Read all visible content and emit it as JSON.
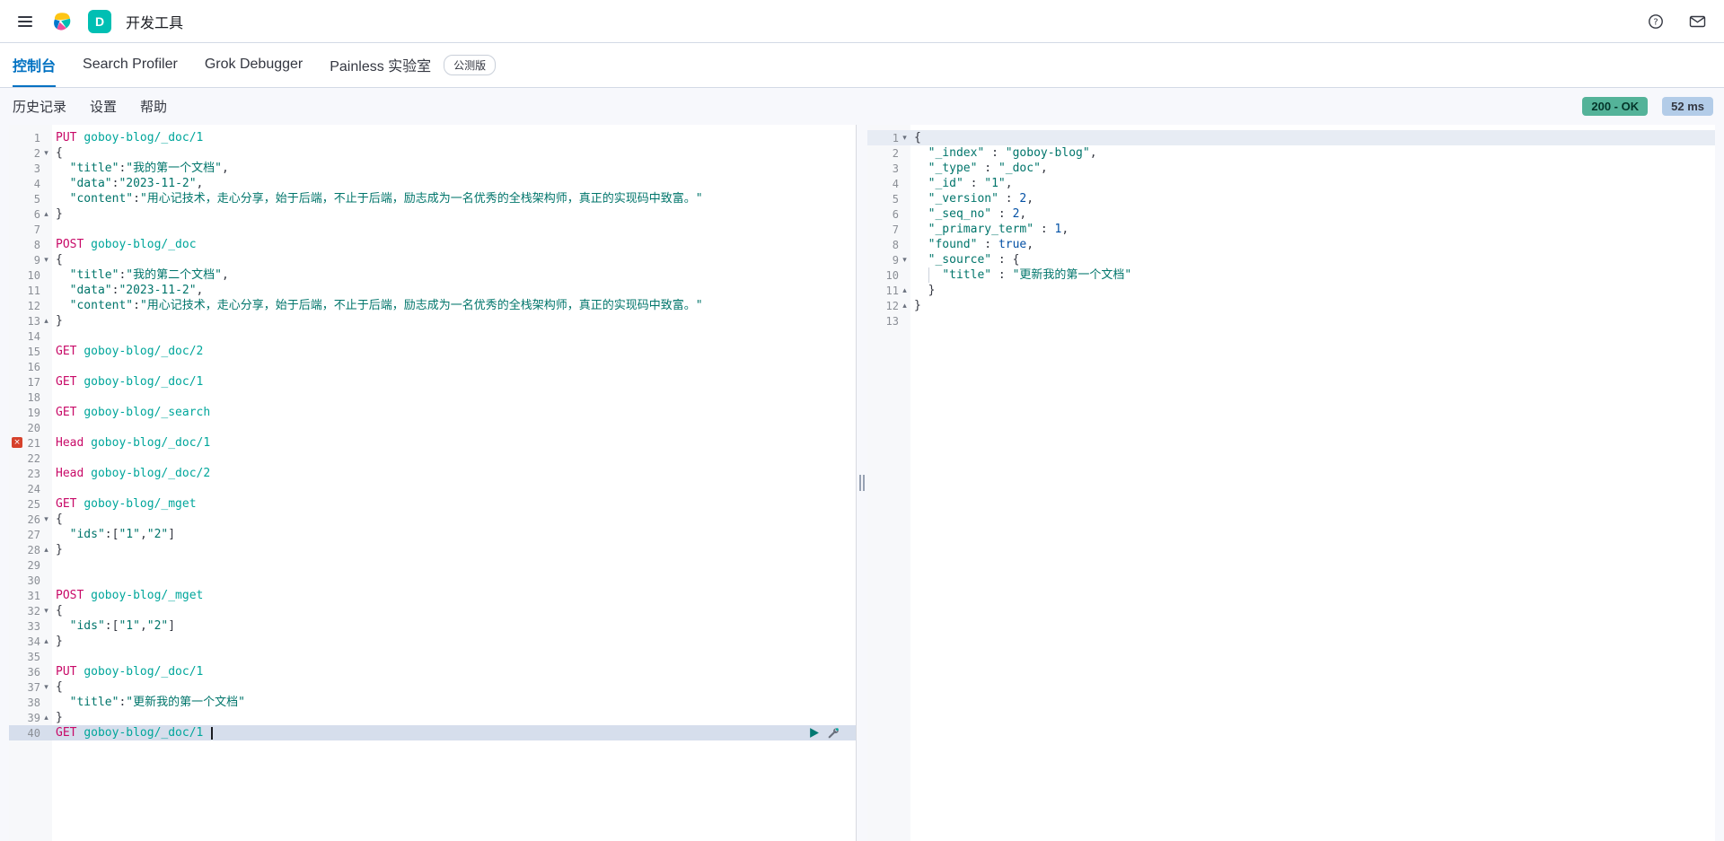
{
  "header": {
    "app_title": "开发工具",
    "space_badge": "D"
  },
  "tabs": [
    {
      "label": "控制台",
      "active": true
    },
    {
      "label": "Search Profiler",
      "active": false
    },
    {
      "label": "Grok Debugger",
      "active": false
    },
    {
      "label": "Painless 实验室",
      "active": false
    }
  ],
  "beta_badge": "公测版",
  "toolbar": {
    "items": [
      "历史记录",
      "设置",
      "帮助"
    ],
    "status_badge": "200 - OK",
    "time_badge": "52 ms"
  },
  "colors": {
    "accent": "#0071c2",
    "status_ok_badge": "#54b399",
    "time_badge": "#b3cce8",
    "method": "#c80a68",
    "url": "#00a69b",
    "string": "#00756b",
    "number": "#0451a5",
    "error_marker": "#d6412b",
    "space_badge": "#00bfb3"
  },
  "icons": {
    "menu": "hamburger-icon",
    "logo": "elastic-logo",
    "help": "help-icon",
    "newsfeed": "newsfeed-icon",
    "send_request": "play-icon",
    "request_options": "wrench-icon",
    "fold_open": "▾",
    "fold_close": "▴",
    "error": "×"
  },
  "editor_left": {
    "lines": [
      {
        "n": 1,
        "tokens": [
          [
            "m",
            "PUT"
          ],
          [
            "t",
            " "
          ],
          [
            "u",
            "goboy-blog/_doc/1"
          ]
        ]
      },
      {
        "n": 2,
        "fold": "open",
        "tokens": [
          [
            "t",
            "{"
          ]
        ]
      },
      {
        "n": 3,
        "tokens": [
          [
            "t",
            "  "
          ],
          [
            "k",
            "\"title\""
          ],
          [
            "t",
            ":"
          ],
          [
            "s",
            "\"我的第一个文档\""
          ],
          [
            "t",
            ","
          ]
        ]
      },
      {
        "n": 4,
        "tokens": [
          [
            "t",
            "  "
          ],
          [
            "k",
            "\"data\""
          ],
          [
            "t",
            ":"
          ],
          [
            "s",
            "\"2023-11-2\""
          ],
          [
            "t",
            ","
          ]
        ]
      },
      {
        "n": 5,
        "tokens": [
          [
            "t",
            "  "
          ],
          [
            "k",
            "\"content\""
          ],
          [
            "t",
            ":"
          ],
          [
            "s",
            "\"用心记技术，走心分享，始于后端，不止于后端，励志成为一名优秀的全栈架构师，真正的实现码中致富。\""
          ]
        ]
      },
      {
        "n": 6,
        "fold": "close",
        "tokens": [
          [
            "t",
            "}"
          ]
        ]
      },
      {
        "n": 7,
        "tokens": []
      },
      {
        "n": 8,
        "tokens": [
          [
            "m",
            "POST"
          ],
          [
            "t",
            " "
          ],
          [
            "u",
            "goboy-blog/_doc"
          ]
        ]
      },
      {
        "n": 9,
        "fold": "open",
        "tokens": [
          [
            "t",
            "{"
          ]
        ]
      },
      {
        "n": 10,
        "tokens": [
          [
            "t",
            "  "
          ],
          [
            "k",
            "\"title\""
          ],
          [
            "t",
            ":"
          ],
          [
            "s",
            "\"我的第二个文档\""
          ],
          [
            "t",
            ","
          ]
        ]
      },
      {
        "n": 11,
        "tokens": [
          [
            "t",
            "  "
          ],
          [
            "k",
            "\"data\""
          ],
          [
            "t",
            ":"
          ],
          [
            "s",
            "\"2023-11-2\""
          ],
          [
            "t",
            ","
          ]
        ]
      },
      {
        "n": 12,
        "tokens": [
          [
            "t",
            "  "
          ],
          [
            "k",
            "\"content\""
          ],
          [
            "t",
            ":"
          ],
          [
            "s",
            "\"用心记技术，走心分享，始于后端，不止于后端，励志成为一名优秀的全栈架构师，真正的实现码中致富。\""
          ]
        ]
      },
      {
        "n": 13,
        "fold": "close",
        "tokens": [
          [
            "t",
            "}"
          ]
        ]
      },
      {
        "n": 14,
        "tokens": []
      },
      {
        "n": 15,
        "tokens": [
          [
            "m",
            "GET"
          ],
          [
            "t",
            " "
          ],
          [
            "u",
            "goboy-blog/_doc/2"
          ]
        ]
      },
      {
        "n": 16,
        "tokens": []
      },
      {
        "n": 17,
        "tokens": [
          [
            "m",
            "GET"
          ],
          [
            "t",
            " "
          ],
          [
            "u",
            "goboy-blog/_doc/1"
          ]
        ]
      },
      {
        "n": 18,
        "tokens": []
      },
      {
        "n": 19,
        "tokens": [
          [
            "m",
            "GET"
          ],
          [
            "t",
            " "
          ],
          [
            "u",
            "goboy-blog/_search"
          ]
        ]
      },
      {
        "n": 20,
        "tokens": []
      },
      {
        "n": 21,
        "error": true,
        "tokens": [
          [
            "m",
            "Head"
          ],
          [
            "t",
            " "
          ],
          [
            "u",
            "goboy-blog/_doc/1"
          ]
        ]
      },
      {
        "n": 22,
        "tokens": []
      },
      {
        "n": 23,
        "tokens": [
          [
            "m",
            "Head"
          ],
          [
            "t",
            " "
          ],
          [
            "u",
            "goboy-blog/_doc/2"
          ]
        ]
      },
      {
        "n": 24,
        "tokens": []
      },
      {
        "n": 25,
        "tokens": [
          [
            "m",
            "GET"
          ],
          [
            "t",
            " "
          ],
          [
            "u",
            "goboy-blog/_mget"
          ]
        ]
      },
      {
        "n": 26,
        "fold": "open",
        "tokens": [
          [
            "t",
            "{"
          ]
        ]
      },
      {
        "n": 27,
        "tokens": [
          [
            "t",
            "  "
          ],
          [
            "k",
            "\"ids\""
          ],
          [
            "t",
            ":["
          ],
          [
            "s",
            "\"1\""
          ],
          [
            "t",
            ","
          ],
          [
            "s",
            "\"2\""
          ],
          [
            "t",
            "]"
          ]
        ]
      },
      {
        "n": 28,
        "fold": "close",
        "tokens": [
          [
            "t",
            "}"
          ]
        ]
      },
      {
        "n": 29,
        "tokens": []
      },
      {
        "n": 30,
        "tokens": []
      },
      {
        "n": 31,
        "tokens": [
          [
            "m",
            "POST"
          ],
          [
            "t",
            " "
          ],
          [
            "u",
            "goboy-blog/_mget"
          ]
        ]
      },
      {
        "n": 32,
        "fold": "open",
        "tokens": [
          [
            "t",
            "{"
          ]
        ]
      },
      {
        "n": 33,
        "tokens": [
          [
            "t",
            "  "
          ],
          [
            "k",
            "\"ids\""
          ],
          [
            "t",
            ":["
          ],
          [
            "s",
            "\"1\""
          ],
          [
            "t",
            ","
          ],
          [
            "s",
            "\"2\""
          ],
          [
            "t",
            "]"
          ]
        ]
      },
      {
        "n": 34,
        "fold": "close",
        "tokens": [
          [
            "t",
            "}"
          ]
        ]
      },
      {
        "n": 35,
        "tokens": []
      },
      {
        "n": 36,
        "tokens": [
          [
            "m",
            "PUT"
          ],
          [
            "t",
            " "
          ],
          [
            "u",
            "goboy-blog/_doc/1"
          ]
        ]
      },
      {
        "n": 37,
        "fold": "open",
        "tokens": [
          [
            "t",
            "{"
          ]
        ]
      },
      {
        "n": 38,
        "tokens": [
          [
            "t",
            "  "
          ],
          [
            "k",
            "\"title\""
          ],
          [
            "t",
            ":"
          ],
          [
            "s",
            "\"更新我的第一个文档\""
          ]
        ]
      },
      {
        "n": 39,
        "fold": "close",
        "tokens": [
          [
            "t",
            "}"
          ]
        ]
      },
      {
        "n": 40,
        "active": true,
        "cursor": true,
        "tokens": [
          [
            "m",
            "GET"
          ],
          [
            "t",
            " "
          ],
          [
            "u",
            "goboy-blog/_doc/1"
          ],
          [
            "t",
            " "
          ]
        ]
      }
    ]
  },
  "editor_right": {
    "lines": [
      {
        "n": 1,
        "fold": "open",
        "active": true,
        "tokens": [
          [
            "t",
            "{"
          ]
        ]
      },
      {
        "n": 2,
        "tokens": [
          [
            "t",
            "  "
          ],
          [
            "k",
            "\"_index\""
          ],
          [
            "t",
            " : "
          ],
          [
            "s",
            "\"goboy-blog\""
          ],
          [
            "t",
            ","
          ]
        ]
      },
      {
        "n": 3,
        "tokens": [
          [
            "t",
            "  "
          ],
          [
            "k",
            "\"_type\""
          ],
          [
            "t",
            " : "
          ],
          [
            "s",
            "\"_doc\""
          ],
          [
            "t",
            ","
          ]
        ]
      },
      {
        "n": 4,
        "tokens": [
          [
            "t",
            "  "
          ],
          [
            "k",
            "\"_id\""
          ],
          [
            "t",
            " : "
          ],
          [
            "s",
            "\"1\""
          ],
          [
            "t",
            ","
          ]
        ]
      },
      {
        "n": 5,
        "tokens": [
          [
            "t",
            "  "
          ],
          [
            "k",
            "\"_version\""
          ],
          [
            "t",
            " : "
          ],
          [
            "n",
            "2"
          ],
          [
            "t",
            ","
          ]
        ]
      },
      {
        "n": 6,
        "tokens": [
          [
            "t",
            "  "
          ],
          [
            "k",
            "\"_seq_no\""
          ],
          [
            "t",
            " : "
          ],
          [
            "n",
            "2"
          ],
          [
            "t",
            ","
          ]
        ]
      },
      {
        "n": 7,
        "tokens": [
          [
            "t",
            "  "
          ],
          [
            "k",
            "\"_primary_term\""
          ],
          [
            "t",
            " : "
          ],
          [
            "n",
            "1"
          ],
          [
            "t",
            ","
          ]
        ]
      },
      {
        "n": 8,
        "tokens": [
          [
            "t",
            "  "
          ],
          [
            "k",
            "\"found\""
          ],
          [
            "t",
            " : "
          ],
          [
            "b",
            "true"
          ],
          [
            "t",
            ","
          ]
        ]
      },
      {
        "n": 9,
        "fold": "open",
        "tokens": [
          [
            "t",
            "  "
          ],
          [
            "k",
            "\"_source\""
          ],
          [
            "t",
            " : {"
          ]
        ]
      },
      {
        "n": 10,
        "tokens": [
          [
            "t",
            "  "
          ],
          [
            "g",
            ""
          ],
          [
            "t",
            "  "
          ],
          [
            "k",
            "\"title\""
          ],
          [
            "t",
            " : "
          ],
          [
            "s",
            "\"更新我的第一个文档\""
          ]
        ]
      },
      {
        "n": 11,
        "fold": "close",
        "tokens": [
          [
            "t",
            "  }"
          ]
        ]
      },
      {
        "n": 12,
        "fold": "close",
        "tokens": [
          [
            "t",
            "}"
          ]
        ]
      },
      {
        "n": 13,
        "tokens": []
      }
    ]
  }
}
